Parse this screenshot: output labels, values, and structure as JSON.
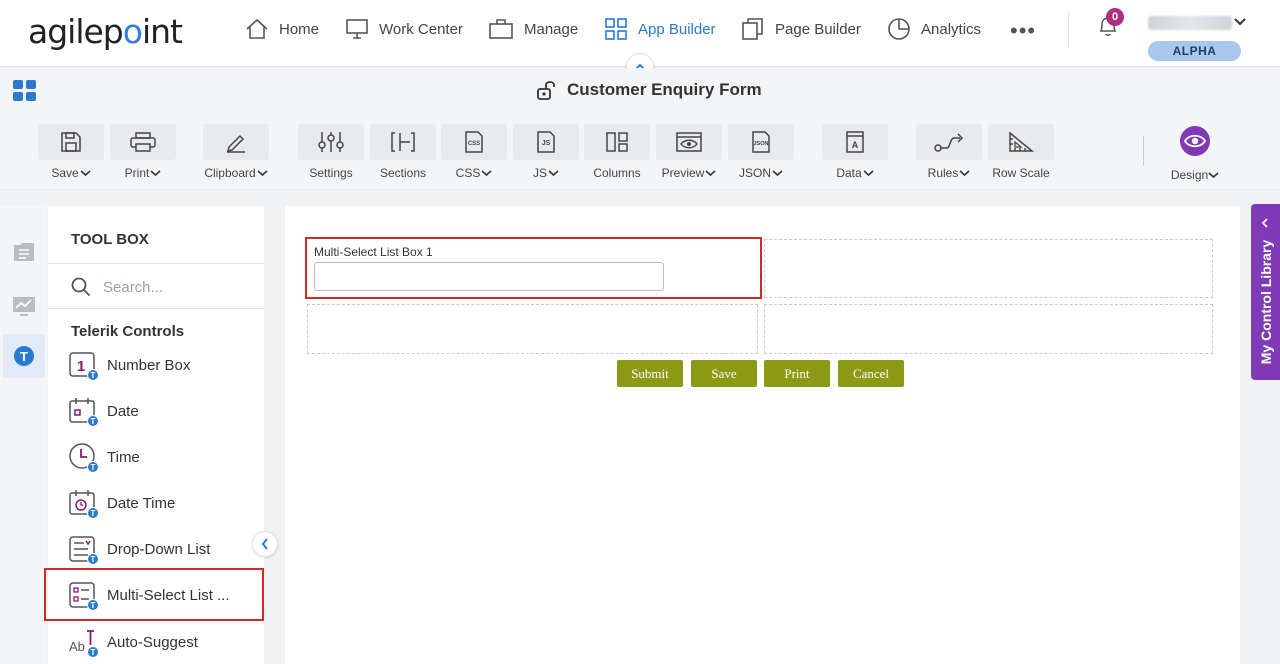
{
  "nav": {
    "logo_left": "agilep",
    "logo_dot": "o",
    "logo_right": "int",
    "items": [
      {
        "label": "Home",
        "icon": "home-icon"
      },
      {
        "label": "Work Center",
        "icon": "monitor-icon"
      },
      {
        "label": "Manage",
        "icon": "briefcase-icon"
      },
      {
        "label": "App Builder",
        "icon": "grid-icon",
        "active": true
      },
      {
        "label": "Page Builder",
        "icon": "copy-icon"
      },
      {
        "label": "Analytics",
        "icon": "pie-chart-icon"
      }
    ],
    "more": "•••",
    "notifications": "0",
    "environment": "ALPHA"
  },
  "titlebar": {
    "title": "Customer Enquiry Form"
  },
  "toolbar": {
    "buttons": [
      {
        "label": "Save",
        "icon": "save-icon",
        "dropdown": true
      },
      {
        "label": "Print",
        "icon": "printer-icon",
        "dropdown": true
      },
      {
        "label": "Clipboard",
        "icon": "pencil-icon",
        "dropdown": true
      },
      {
        "label": "Settings",
        "icon": "sliders-icon",
        "dropdown": false
      },
      {
        "label": "Sections",
        "icon": "sections-icon",
        "dropdown": false
      },
      {
        "label": "CSS",
        "icon": "css-file-icon",
        "dropdown": true
      },
      {
        "label": "JS",
        "icon": "js-file-icon",
        "dropdown": true
      },
      {
        "label": "Columns",
        "icon": "columns-icon",
        "dropdown": false
      },
      {
        "label": "Preview",
        "icon": "eye-window-icon",
        "dropdown": true
      },
      {
        "label": "JSON",
        "icon": "json-file-icon",
        "dropdown": true
      },
      {
        "label": "Data",
        "icon": "data-icon",
        "dropdown": true
      },
      {
        "label": "Rules",
        "icon": "rules-icon",
        "dropdown": true
      },
      {
        "label": "Row Scale",
        "icon": "ruler-icon",
        "dropdown": false
      }
    ],
    "design_label": "Design",
    "accent": "#7e3bb5"
  },
  "toolbox": {
    "title": "TOOL BOX",
    "search_placeholder": "Search...",
    "section": "Telerik Controls",
    "controls": [
      {
        "label": "Number Box",
        "icon": "number-box-icon"
      },
      {
        "label": "Date",
        "icon": "calendar-icon"
      },
      {
        "label": "Time",
        "icon": "clock-icon"
      },
      {
        "label": "Date Time",
        "icon": "calendar-clock-icon"
      },
      {
        "label": "Drop-Down List",
        "icon": "dropdown-list-icon"
      },
      {
        "label": "Multi-Select List ...",
        "icon": "multi-select-list-icon"
      },
      {
        "label": "Auto-Suggest",
        "icon": "auto-suggest-icon"
      }
    ]
  },
  "form": {
    "field_label": "Multi-Select List Box 1",
    "buttons": [
      "Submit",
      "Save",
      "Print",
      "Cancel"
    ],
    "button_color": "#8a9a14"
  },
  "right_panel": {
    "label": "My Control Library"
  }
}
